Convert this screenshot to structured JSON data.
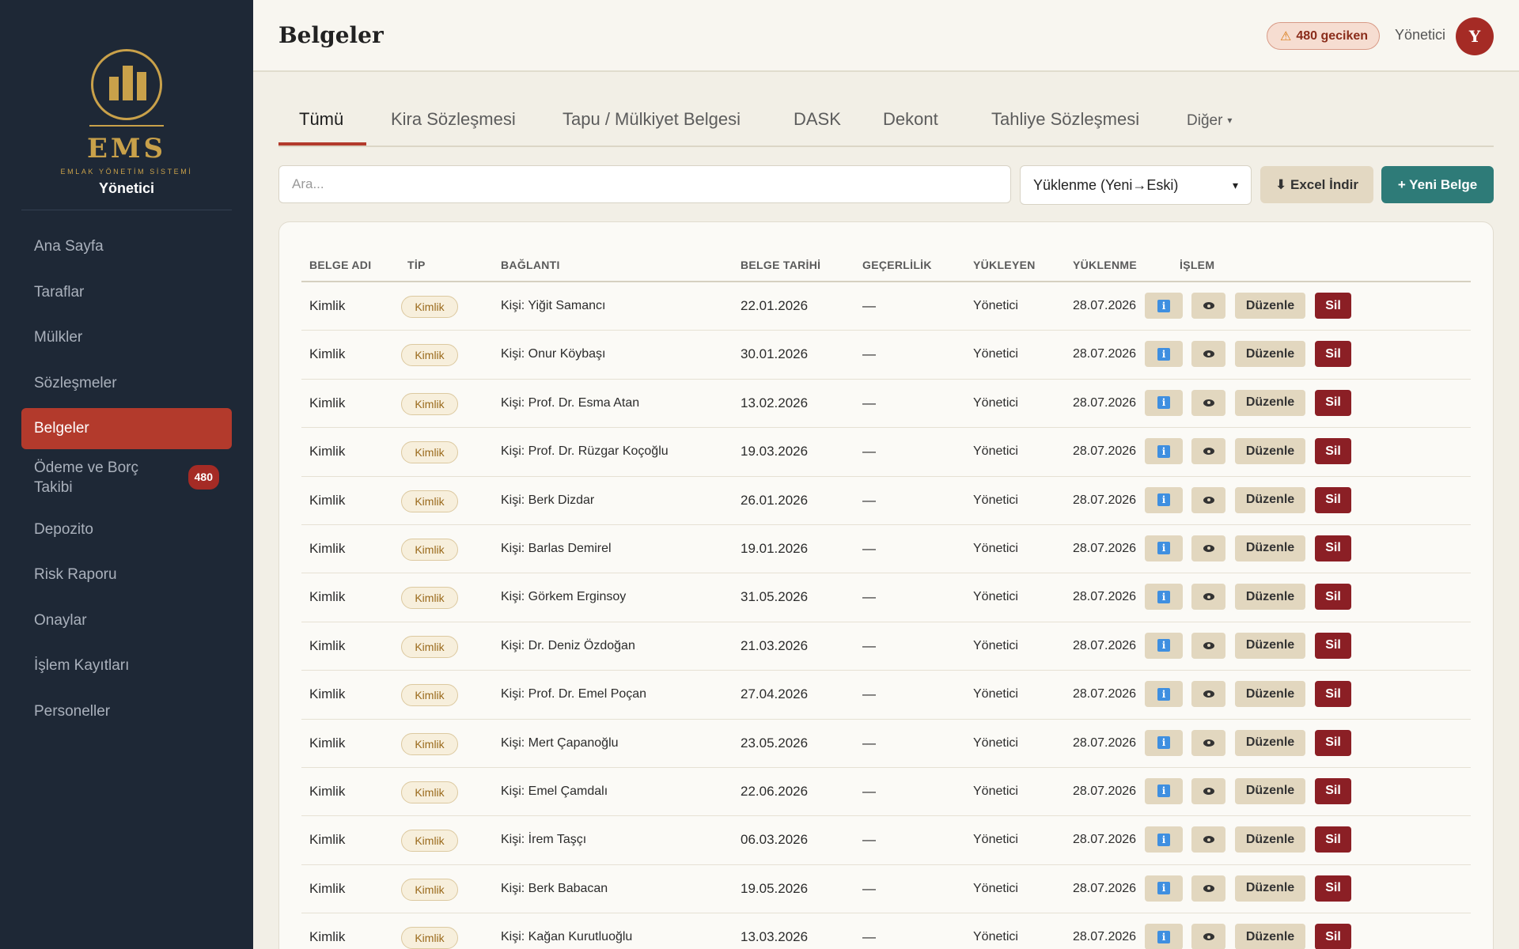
{
  "brand": {
    "name": "EMS",
    "subtitle": "EMLAK YÖNETİM SİSTEMİ",
    "role": "Yönetici",
    "accent": "#c9a14a"
  },
  "sidebar": {
    "items": [
      {
        "label": "Ana Sayfa",
        "active": false
      },
      {
        "label": "Taraflar",
        "active": false
      },
      {
        "label": "Mülkler",
        "active": false
      },
      {
        "label": "Sözleşmeler",
        "active": false
      },
      {
        "label": "Belgeler",
        "active": true
      },
      {
        "label": "Ödeme ve Borç Takibi",
        "active": false,
        "badge": "480"
      },
      {
        "label": "Depozito",
        "active": false
      },
      {
        "label": "Risk Raporu",
        "active": false
      },
      {
        "label": "Onaylar",
        "active": false
      },
      {
        "label": "İşlem Kayıtları",
        "active": false
      },
      {
        "label": "Personeller",
        "active": false
      }
    ]
  },
  "header": {
    "title": "Belgeler",
    "overdue_label": "480 geciken",
    "user_name": "Yönetici",
    "avatar_initial": "Y",
    "warning_icon": "warning-triangle-icon"
  },
  "tabs": [
    {
      "label": "Tümü",
      "active": true
    },
    {
      "label": "Kira Sözleşmesi",
      "active": false
    },
    {
      "label": "Tapu / Mülkiyet Belgesi",
      "active": false
    },
    {
      "label": "DASK",
      "active": false
    },
    {
      "label": "Dekont",
      "active": false
    },
    {
      "label": "Tahliye Sözleşmesi",
      "active": false
    },
    {
      "label": "Diğer",
      "active": false,
      "dropdown": true
    }
  ],
  "toolbar": {
    "search_placeholder": "Ara...",
    "sort_value": "Yüklenme (Yeni→Eski)",
    "excel_label": "⬇ Excel İndir",
    "new_label": "+ Yeni Belge"
  },
  "table": {
    "columns": [
      "BELGE ADI",
      "TİP",
      "BAĞLANTI",
      "BELGE TARİHİ",
      "GEÇERLİLİK",
      "YÜKLEYEN",
      "YÜKLENME",
      "İŞLEM"
    ],
    "actions": {
      "edit": "Düzenle",
      "delete": "Sil",
      "info_icon": "info-icon",
      "view_icon": "eye-icon"
    },
    "rows": [
      {
        "name": "Kimlik",
        "type": "Kimlik",
        "link": "Kişi: Yiğit Samancı",
        "date": "22.01.2026",
        "validity": "—",
        "uploader": "Yönetici",
        "uploaded": "28.07.2026"
      },
      {
        "name": "Kimlik",
        "type": "Kimlik",
        "link": "Kişi: Onur Köybaşı",
        "date": "30.01.2026",
        "validity": "—",
        "uploader": "Yönetici",
        "uploaded": "28.07.2026"
      },
      {
        "name": "Kimlik",
        "type": "Kimlik",
        "link": "Kişi: Prof. Dr. Esma Atan",
        "date": "13.02.2026",
        "validity": "—",
        "uploader": "Yönetici",
        "uploaded": "28.07.2026"
      },
      {
        "name": "Kimlik",
        "type": "Kimlik",
        "link": "Kişi: Prof. Dr. Rüzgar Koçoğlu",
        "date": "19.03.2026",
        "validity": "—",
        "uploader": "Yönetici",
        "uploaded": "28.07.2026"
      },
      {
        "name": "Kimlik",
        "type": "Kimlik",
        "link": "Kişi: Berk Dizdar",
        "date": "26.01.2026",
        "validity": "—",
        "uploader": "Yönetici",
        "uploaded": "28.07.2026"
      },
      {
        "name": "Kimlik",
        "type": "Kimlik",
        "link": "Kişi: Barlas Demirel",
        "date": "19.01.2026",
        "validity": "—",
        "uploader": "Yönetici",
        "uploaded": "28.07.2026"
      },
      {
        "name": "Kimlik",
        "type": "Kimlik",
        "link": "Kişi: Görkem Erginsoy",
        "date": "31.05.2026",
        "validity": "—",
        "uploader": "Yönetici",
        "uploaded": "28.07.2026"
      },
      {
        "name": "Kimlik",
        "type": "Kimlik",
        "link": "Kişi: Dr. Deniz Özdoğan",
        "date": "21.03.2026",
        "validity": "—",
        "uploader": "Yönetici",
        "uploaded": "28.07.2026"
      },
      {
        "name": "Kimlik",
        "type": "Kimlik",
        "link": "Kişi: Prof. Dr. Emel Poçan",
        "date": "27.04.2026",
        "validity": "—",
        "uploader": "Yönetici",
        "uploaded": "28.07.2026"
      },
      {
        "name": "Kimlik",
        "type": "Kimlik",
        "link": "Kişi: Mert Çapanoğlu",
        "date": "23.05.2026",
        "validity": "—",
        "uploader": "Yönetici",
        "uploaded": "28.07.2026"
      },
      {
        "name": "Kimlik",
        "type": "Kimlik",
        "link": "Kişi: Emel Çamdalı",
        "date": "22.06.2026",
        "validity": "—",
        "uploader": "Yönetici",
        "uploaded": "28.07.2026"
      },
      {
        "name": "Kimlik",
        "type": "Kimlik",
        "link": "Kişi: İrem Taşçı",
        "date": "06.03.2026",
        "validity": "—",
        "uploader": "Yönetici",
        "uploaded": "28.07.2026"
      },
      {
        "name": "Kimlik",
        "type": "Kimlik",
        "link": "Kişi: Berk Babacan",
        "date": "19.05.2026",
        "validity": "—",
        "uploader": "Yönetici",
        "uploaded": "28.07.2026"
      },
      {
        "name": "Kimlik",
        "type": "Kimlik",
        "link": "Kişi: Kağan Kurutluoğlu",
        "date": "13.03.2026",
        "validity": "—",
        "uploader": "Yönetici",
        "uploaded": "28.07.2026"
      }
    ]
  },
  "colors": {
    "sidebar_bg": "#1e2836",
    "active_nav": "#b33a2c",
    "primary_button": "#2e7b78",
    "delete_button": "#8b1f25",
    "page_bg": "#f2efe6"
  }
}
